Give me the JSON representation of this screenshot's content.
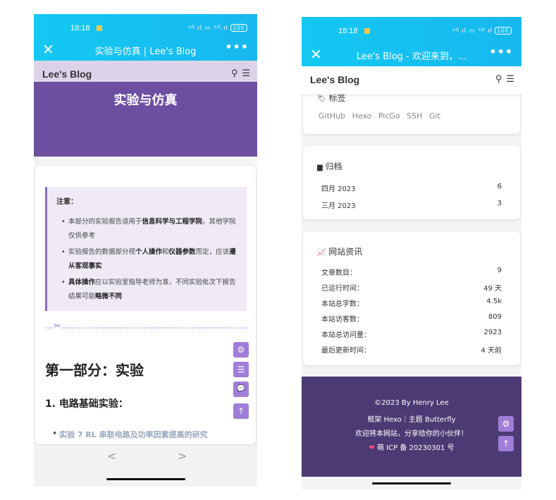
{
  "left": {
    "status": {
      "time": "18:18",
      "signal": "⁴ᴳ.ıl ▭ ⁵ᴳ.ıl",
      "battery": "100"
    },
    "titlebar": {
      "close": "✕",
      "title": "实验与仿真 | Lee's Blog",
      "more": "•••"
    },
    "nav": {
      "brand": "Lee's Blog",
      "search_icon": "⚲",
      "menu_icon": "☰"
    },
    "hero": {
      "title": "实验与仿真"
    },
    "note": {
      "title": "注意：",
      "items": [
        {
          "a": "本部分的实验报告适用于",
          "b": "信息科学与工程学院",
          "c": "，其他学院仅供参考"
        },
        {
          "a": "实验报告的数据部分视",
          "b": "个人操作",
          "c": "和",
          "d": "仪器参数",
          "e": "而定，应该",
          "f": "遵从客观事实"
        },
        {
          "a": "具体操作",
          "b": "应以实验室指导老师为准，不同实验批次下报告结果可能",
          "c": "略微不同"
        }
      ]
    },
    "scissors": "✂",
    "h2": "第一部分：实验",
    "h3": "1. 电路基础实验：",
    "link": "实验 7 RL 串联电路及功率因素提高的研究",
    "fabs": {
      "settings": "⚙",
      "toc": "☰",
      "comment": "💬",
      "top": "↑"
    },
    "bottom": {
      "back": "<",
      "forward": ">"
    }
  },
  "right": {
    "status": {
      "time": "18:18",
      "signal": "⁴ᴳ.ıl ▭ ⁵ᴳ.ıl",
      "battery": "100"
    },
    "titlebar": {
      "close": "✕",
      "title": "Lee's Blog - 欢迎来到，...",
      "more": "•••"
    },
    "nav": {
      "brand": "Lee's Blog",
      "search_icon": "⚲",
      "menu_icon": "☰"
    },
    "tags": {
      "icon": "🏷",
      "title": "标签",
      "items": [
        "GitHub",
        "Hexo",
        "PicGo",
        "SSH",
        "Git"
      ]
    },
    "archive": {
      "icon": "▆",
      "title": "归档",
      "rows": [
        {
          "label": "四月 2023",
          "value": "6"
        },
        {
          "label": "三月 2023",
          "value": "3"
        }
      ]
    },
    "info": {
      "icon": "📈",
      "title": "网站资讯",
      "rows": [
        {
          "label": "文章数目：",
          "value": "9"
        },
        {
          "label": "已运行时间：",
          "value": "49 天"
        },
        {
          "label": "本站总字数：",
          "value": "4.5k"
        },
        {
          "label": "本站访客数：",
          "value": "809"
        },
        {
          "label": "本站总访问量：",
          "value": "2923"
        },
        {
          "label": "最后更新时间：",
          "value": "4 天前"
        }
      ]
    },
    "footer": {
      "copyright": "©2023 By Henry Lee",
      "framework": "框架 Hexo｜主题 Butterfly",
      "welcome": "欢迎将本网站，分享给你的小伙伴！",
      "icp_icon": "❤",
      "icp": "萌 ICP 备 20230301 号"
    },
    "fabs": {
      "settings": "⚙",
      "top": "↑"
    }
  },
  "colors": {
    "statusbar": "#14c8f2",
    "hero": "#6c4fa0",
    "accent": "#9f7ed8",
    "footer": "#4c3a74"
  }
}
